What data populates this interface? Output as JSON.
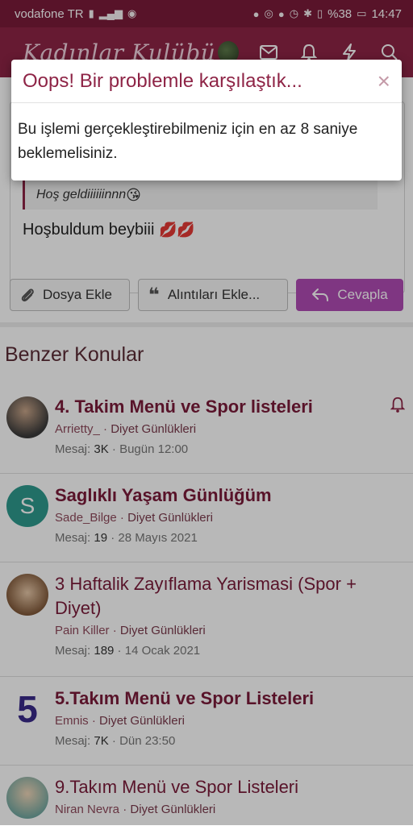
{
  "status_bar": {
    "carrier": "vodafone TR",
    "battery": "%38",
    "time": "14:47"
  },
  "header": {
    "logo_text": "Kadınlar Kulübü"
  },
  "message": {
    "quote_text": "Hoş geldiiiiiinnn",
    "reply_text": "Hoşbuldum beybiii"
  },
  "buttons": {
    "attach": "Dosya Ekle",
    "quotes": "Alıntıları Ekle...",
    "reply": "Cevapla"
  },
  "similar": {
    "title": "Benzer Konular",
    "threads": [
      {
        "title": "4. Takim Menü ve Spor listeleri",
        "author": "Arrietty_",
        "category": "Diyet Günlükleri",
        "stats_label": "Mesaj:",
        "count": "3K",
        "date": "Bugün 12:00"
      },
      {
        "title": "Saglıklı Yaşam Günlüğüm",
        "author": "Sade_Bilge",
        "category": "Diyet Günlükleri",
        "stats_label": "Mesaj:",
        "count": "19",
        "date": "28 Mayıs 2021",
        "avatar_letter": "S"
      },
      {
        "title": "3 Haftalik Zayıflama Yarismasi (Spor + Diyet)",
        "author": "Pain Killer",
        "category": "Diyet Günlükleri",
        "stats_label": "Mesaj:",
        "count": "189",
        "date": "14 Ocak 2021"
      },
      {
        "title": "5.Takım Menü ve Spor Listeleri",
        "author": "Emnis",
        "category": "Diyet Günlükleri",
        "stats_label": "Mesaj:",
        "count": "7K",
        "date": "Dün 23:50",
        "avatar_letter": "5"
      },
      {
        "title": "9.Takım Menü ve Spor Listeleri",
        "author": "Niran Nevra",
        "category": "Diyet Günlükleri"
      }
    ]
  },
  "modal": {
    "title": "Oops! Bir problemle karşılaştık...",
    "body": "Bu işlemi gerçekleştirebilmeniz için en az 8 saniye beklemelisiniz.",
    "close_icon": "×"
  },
  "colors": {
    "brand": "#8e2446",
    "accent": "#b04bb5",
    "status_bar": "#7a1b3a"
  }
}
